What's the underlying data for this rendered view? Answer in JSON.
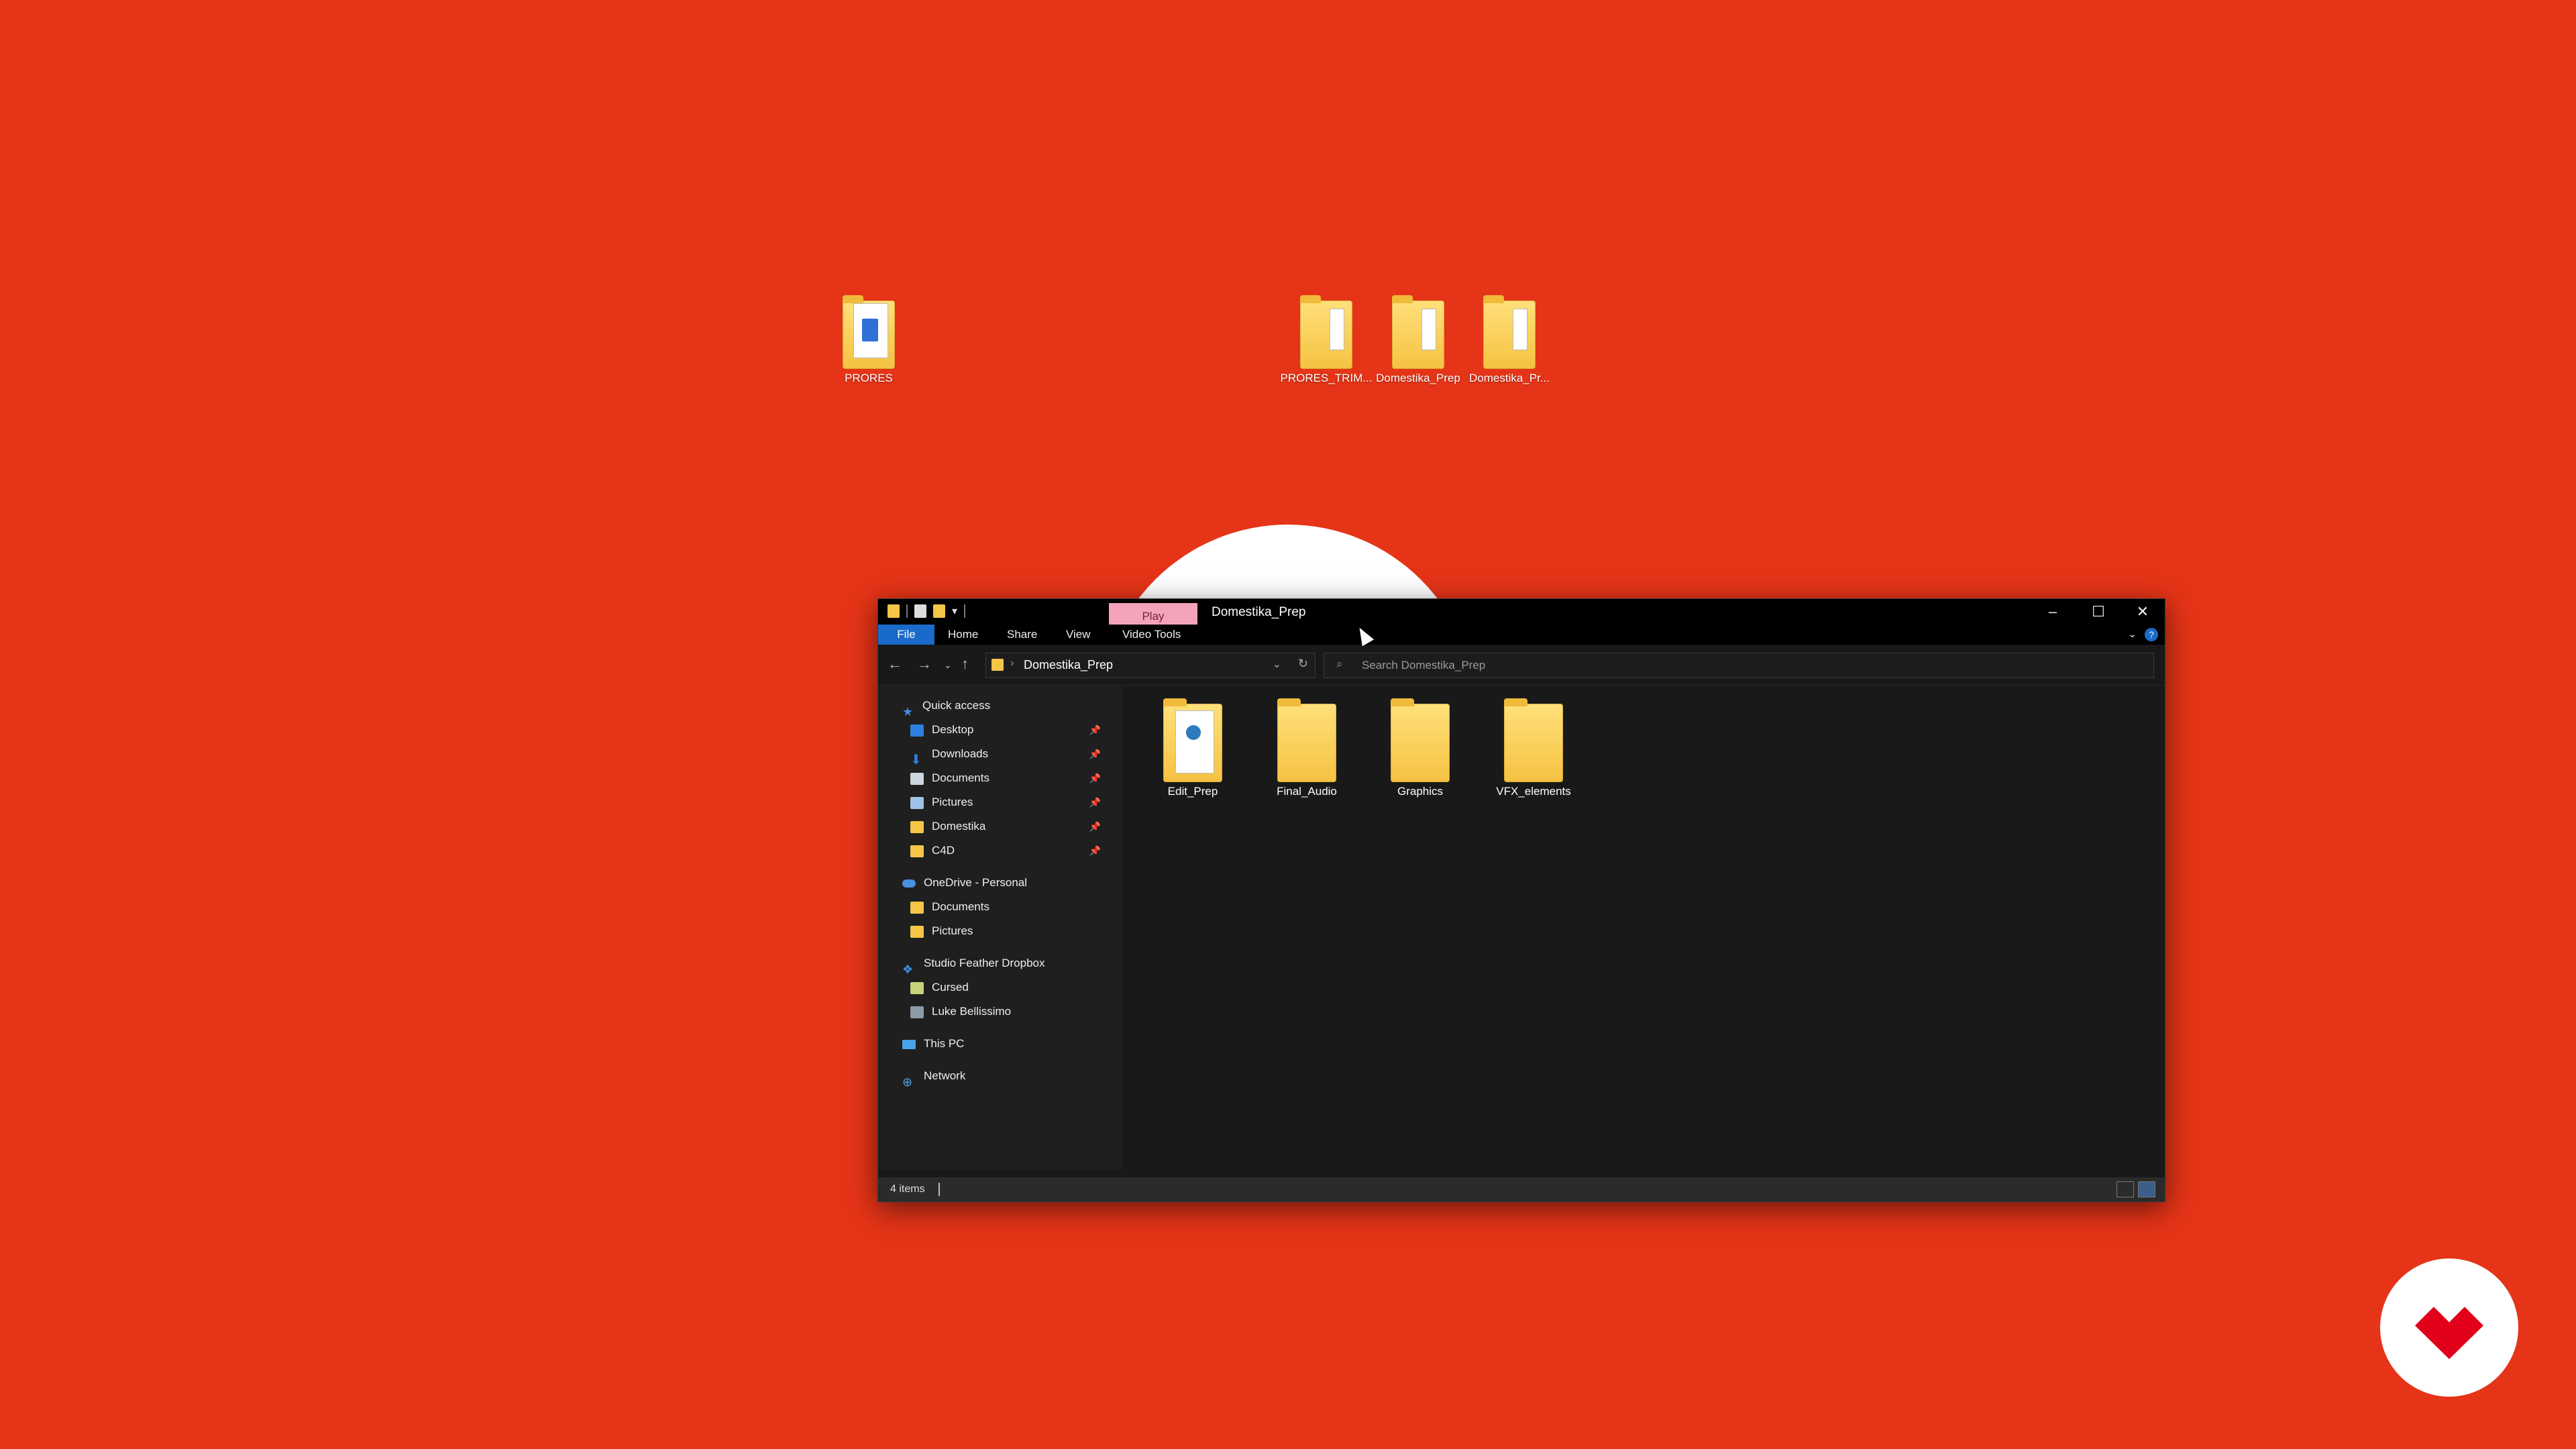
{
  "desktop": {
    "background_color": "#e53417",
    "icons": [
      {
        "label": "PRORES",
        "icon": "video-file-icon"
      },
      {
        "label": "PRORES_TRIM...",
        "icon": "folder-icon"
      },
      {
        "label": "Domestika_Prep",
        "icon": "folder-icon"
      },
      {
        "label": "Domestika_Pr...",
        "icon": "folder-icon"
      }
    ]
  },
  "window": {
    "title": "Domestika_Prep",
    "contextual_tab": "Play",
    "contextual_tab_color": "#f5a3ba",
    "ribbon_tabs": [
      "File",
      "Home",
      "Share",
      "View",
      "Video Tools"
    ],
    "address": {
      "breadcrumb": "Domestika_Prep"
    },
    "search": {
      "placeholder": "Search Domestika_Prep"
    },
    "nav": {
      "quick_access": "Quick access",
      "quick_items": [
        "Desktop",
        "Downloads",
        "Documents",
        "Pictures",
        "Domestika",
        "C4D"
      ],
      "onedrive": "OneDrive - Personal",
      "onedrive_items": [
        "Documents",
        "Pictures"
      ],
      "dropbox": "Studio Feather Dropbox",
      "dropbox_items": [
        "Cursed",
        "Luke Bellissimo"
      ],
      "this_pc": "This PC",
      "network": "Network"
    },
    "items": [
      {
        "label": "Edit_Prep",
        "icon": "folder-with-documents-icon"
      },
      {
        "label": "Final_Audio",
        "icon": "folder-icon"
      },
      {
        "label": "Graphics",
        "icon": "folder-icon"
      },
      {
        "label": "VFX_elements",
        "icon": "folder-icon"
      }
    ],
    "status": {
      "count": "4 items"
    },
    "accent_color": "#1a6bc9"
  },
  "brand": {
    "logo": "domestika-logo-icon",
    "color": "#e2001a"
  }
}
